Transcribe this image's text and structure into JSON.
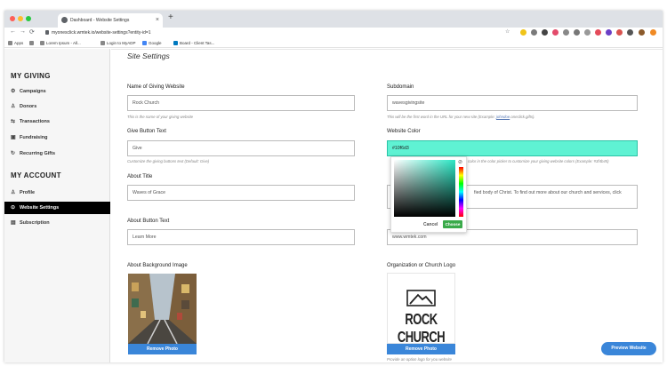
{
  "browser": {
    "tab_title": "Dashboard - Website Settings",
    "tab_close": "×",
    "new_tab": "+",
    "url": "myonesclick.wmtek.io/website-settings?entity-id=1",
    "bookmarks": [
      "Apps",
      "Lorem Ipsum - All...",
      "Login to MyADP",
      "Google",
      "Board - Client Tas..."
    ]
  },
  "sidebar": {
    "my_giving_heading": "MY GIVING",
    "my_giving_items": [
      {
        "label": "Campaigns",
        "icon": "gear-icon"
      },
      {
        "label": "Donors",
        "icon": "users-icon"
      },
      {
        "label": "Transactions",
        "icon": "transactions-icon"
      },
      {
        "label": "Fundraising",
        "icon": "fundraising-icon"
      },
      {
        "label": "Recurring Gifts",
        "icon": "recurring-icon"
      }
    ],
    "my_account_heading": "MY ACCOUNT",
    "my_account_items": [
      {
        "label": "Profile",
        "icon": "profile-icon"
      },
      {
        "label": "Website Settings",
        "icon": "settings-icon",
        "active": true
      },
      {
        "label": "Subscription",
        "icon": "subscription-icon"
      }
    ]
  },
  "main": {
    "title": "Site Settings",
    "name_label": "Name of Giving Website",
    "name_value": "Rock Church",
    "name_help": "This is the name of your giving website",
    "subdomain_label": "Subdomain",
    "subdomain_value": "wavesgivingsite",
    "subdomain_help_pre": "This will be the first word in the URL for your new site (Example: ",
    "subdomain_help_link": "johndoe",
    "subdomain_help_post": ".oneclick.gifts).",
    "give_label": "Give Button Text",
    "give_value": "Give",
    "give_help": "Customize the giving buttons text (Default: Give)",
    "color_label": "Website Color",
    "color_value": "#10f6d3",
    "color_help": "color in the color picker to customize your giving website colors (Example: #3f4b45)",
    "about_title_label": "About Title",
    "about_title_value": "Waves of Grace",
    "about_text_value": "fied body of Christ. To find out more about our church and services, click",
    "about_button_label": "About Button Text",
    "about_button_value": "Learn More",
    "website_value": "www.wmtek.com",
    "bg_image_label": "About Background Image",
    "logo_label": "Organization or Church Logo",
    "logo_text": "ROCK CHURCH",
    "remove_photo": "Remove Photo",
    "logo_help": "Provide an option logo for you website",
    "preview_button": "Preview Website"
  },
  "color_picker": {
    "cancel": "Cancel",
    "choose": "Choose",
    "accent": "#10f6d3"
  }
}
